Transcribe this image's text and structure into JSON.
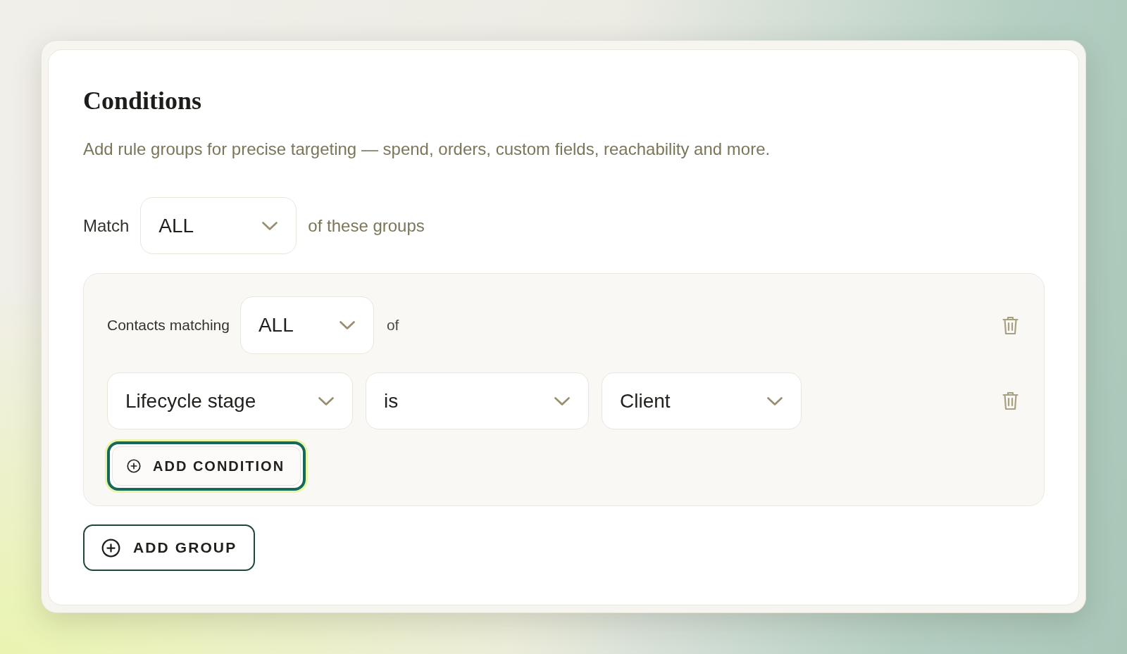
{
  "section": {
    "title": "Conditions",
    "description": "Add rule groups for precise targeting — spend, orders, custom fields, reachability and more."
  },
  "match": {
    "label": "Match",
    "value": "ALL",
    "suffix": "of these groups"
  },
  "groups": [
    {
      "label": "Contacts matching",
      "value": "ALL",
      "suffix": "of",
      "conditions": [
        {
          "field": "Lifecycle stage",
          "operator": "is",
          "value": "Client"
        }
      ],
      "add_condition": {
        "label": "ADD CONDITION",
        "focused": true
      }
    }
  ],
  "add_group": {
    "label": "ADD GROUP"
  }
}
